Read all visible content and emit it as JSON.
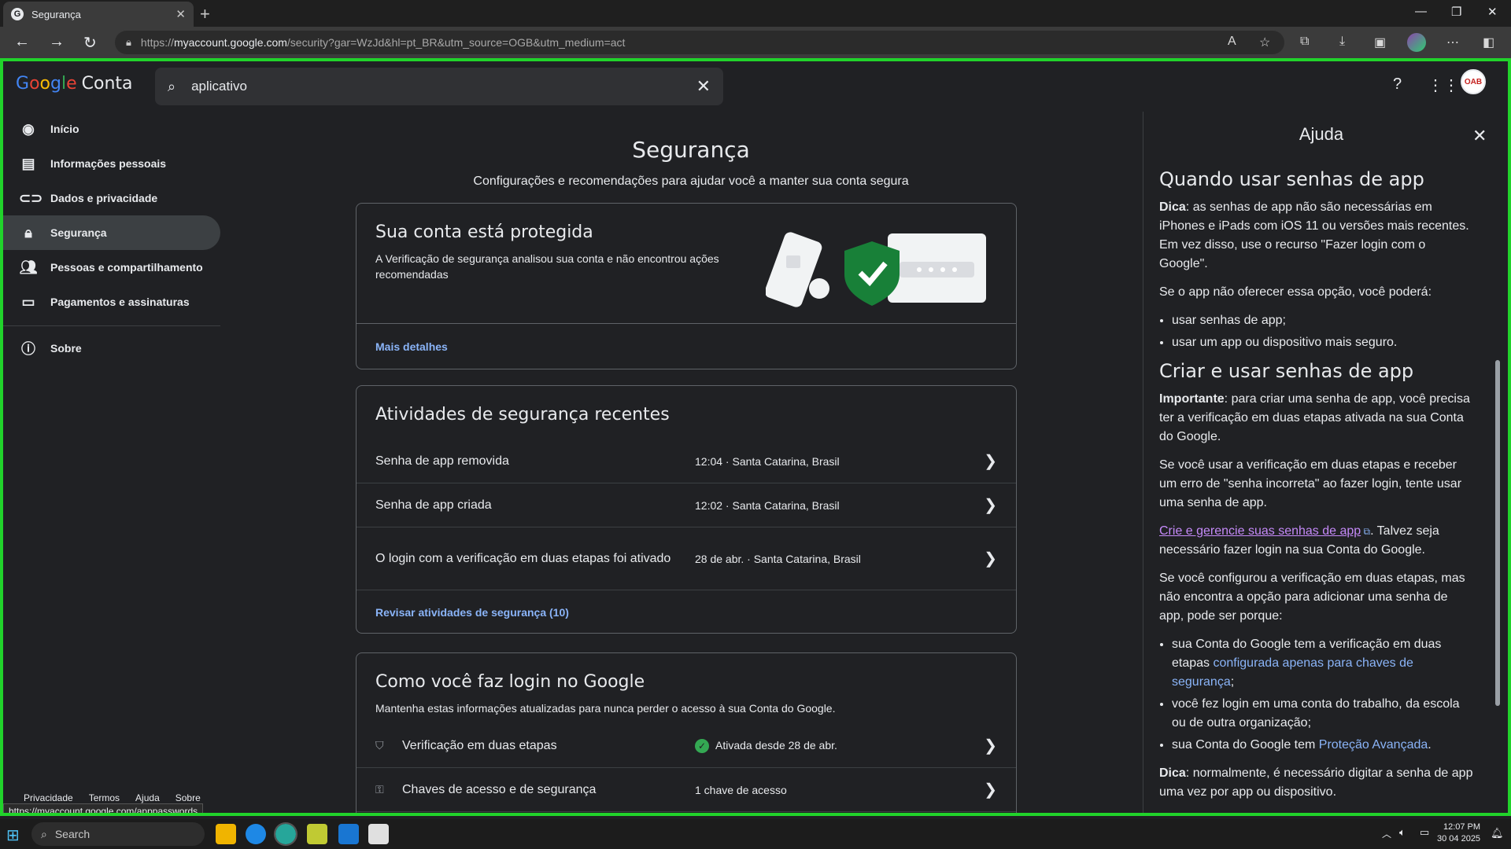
{
  "browser": {
    "tab_title": "Segurança",
    "tab_favicon": "G",
    "url_prefix": "https://",
    "url_host": "myaccount.google.com",
    "url_rest": "/security?gar=WzJd&hl=pt_BR&utm_source=OGB&utm_medium=act",
    "status_url": "https://myaccount.google.com/apppasswords"
  },
  "header": {
    "logo_letters": [
      "G",
      "o",
      "o",
      "g",
      "l",
      "e"
    ],
    "logo_suffix": "Conta",
    "search_value": "aplicativo",
    "avatar_text": "OAB"
  },
  "sidebar": {
    "items": [
      {
        "label": "Início",
        "icon": "person-circle-icon"
      },
      {
        "label": "Informações pessoais",
        "icon": "id-card-icon"
      },
      {
        "label": "Dados e privacidade",
        "icon": "toggle-icon"
      },
      {
        "label": "Segurança",
        "icon": "lock-icon"
      },
      {
        "label": "Pessoas e compartilhamento",
        "icon": "people-icon"
      },
      {
        "label": "Pagamentos e assinaturas",
        "icon": "credit-card-icon"
      },
      {
        "label": "Sobre",
        "icon": "info-icon"
      }
    ],
    "footer": [
      "Privacidade",
      "Termos",
      "Ajuda",
      "Sobre"
    ]
  },
  "main": {
    "title": "Segurança",
    "subtitle": "Configurações e recomendações para ajudar você a manter sua conta segura",
    "protected_card": {
      "title": "Sua conta está protegida",
      "desc": "A Verificação de segurança analisou sua conta e não encontrou ações recomendadas",
      "link": "Mais detalhes"
    },
    "activity_card": {
      "title": "Atividades de segurança recentes",
      "rows": [
        {
          "name": "Senha de app removida",
          "meta": "12:04 · Santa Catarina, Brasil"
        },
        {
          "name": "Senha de app criada",
          "meta": "12:02 · Santa Catarina, Brasil"
        },
        {
          "name": "O login com a verificação em duas etapas foi ativado",
          "meta": "28 de abr. · Santa Catarina, Brasil"
        }
      ],
      "link": "Revisar atividades de segurança (10)"
    },
    "login_card": {
      "title": "Como você faz login no Google",
      "desc": "Mantenha estas informações atualizadas para nunca perder o acesso à sua Conta do Google.",
      "rows": [
        {
          "name": "Verificação em duas etapas",
          "meta": "Ativada desde 28 de abr."
        },
        {
          "name": "Chaves de acesso e de segurança",
          "meta": "1 chave de acesso"
        }
      ]
    }
  },
  "help": {
    "title": "Ajuda",
    "h1": "Quando usar senhas de app",
    "p1_bold": "Dica",
    "p1": ": as senhas de app não são necessárias em iPhones e iPads com iOS 11 ou versões mais recentes. Em vez disso, use o recurso \"Fazer login com o Google\".",
    "p2": "Se o app não oferecer essa opção, você poderá:",
    "list1": [
      "usar senhas de app;",
      "usar um app ou dispositivo mais seguro."
    ],
    "h2": "Criar e usar senhas de app",
    "p3_bold": "Importante",
    "p3": ": para criar uma senha de app, você precisa ter a verificação em duas etapas ativada na sua Conta do Google.",
    "p4": "Se você usar a verificação em duas etapas e receber um erro de \"senha incorreta\" ao fazer login, tente usar uma senha de app.",
    "p5_link": "Crie e gerencie suas senhas de app",
    "p5": ". Talvez seja necessário fazer login na sua Conta do Google.",
    "p6": "Se você configurou a verificação em duas etapas, mas não encontra a opção para adicionar uma senha de app, pode ser porque:",
    "list2_a": "sua Conta do Google tem a verificação em duas etapas ",
    "list2_a_link": "configurada apenas para chaves de segurança",
    "list2_a_end": ";",
    "list2_b": "você fez login em uma conta do trabalho, da escola ou de outra organização;",
    "list2_c": "sua Conta do Google tem ",
    "list2_c_link": "Proteção Avançada",
    "list2_c_end": ".",
    "p7_bold": "Dica",
    "p7": ": normalmente, é necessário digitar a senha de app uma vez por app ou dispositivo."
  },
  "taskbar": {
    "search_placeholder": "Search",
    "time": "12:07 PM",
    "date": "30 04 2025"
  }
}
